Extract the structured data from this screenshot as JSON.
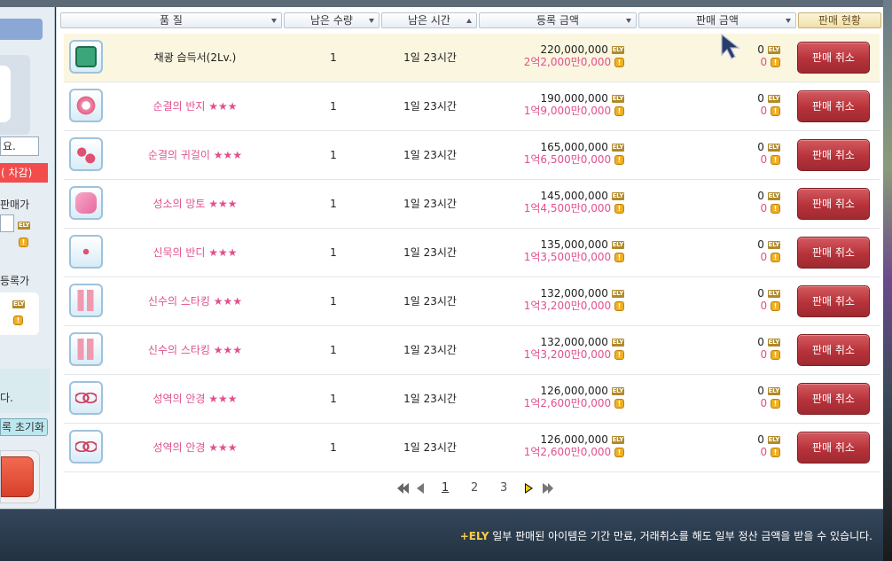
{
  "left_panel": {
    "field_text": "요.",
    "red_text": "( 차감)",
    "seller_label": "판매가",
    "register_label": "등록가",
    "info_text": "다.",
    "reset_label": "록 초기화"
  },
  "header": {
    "quality": "품 질",
    "remaining_qty": "남은 수량",
    "remaining_time": "남은 시간",
    "register_price": "등록 금액",
    "sale_price": "판매 금액",
    "sale_status": "판매 현황"
  },
  "ely_label": "ELY",
  "cancel_label": "판매 취소",
  "stars": "★★★",
  "rows": [
    {
      "name": "채광 습득서(2Lv.)",
      "stars": "",
      "qty": "1",
      "time": "1일 23시간",
      "price": "220,000,000",
      "price_won": "2억2,000만0,000",
      "sale": "0",
      "sale_won": "0",
      "icon": "book-icon",
      "highlight": true
    },
    {
      "name": "순결의 반지",
      "stars": "★★★",
      "qty": "1",
      "time": "1일 23시간",
      "price": "190,000,000",
      "price_won": "1억9,000만0,000",
      "sale": "0",
      "sale_won": "0",
      "icon": "ring-icon",
      "highlight": false
    },
    {
      "name": "순결의 귀걸이",
      "stars": "★★★",
      "qty": "1",
      "time": "1일 23시간",
      "price": "165,000,000",
      "price_won": "1억6,500만0,000",
      "sale": "0",
      "sale_won": "0",
      "icon": "earring-icon",
      "highlight": false
    },
    {
      "name": "성소의 망토",
      "stars": "★★★",
      "qty": "1",
      "time": "1일 23시간",
      "price": "145,000,000",
      "price_won": "1억4,500만0,000",
      "sale": "0",
      "sale_won": "0",
      "icon": "cape-icon",
      "highlight": false
    },
    {
      "name": "신묵의 반디",
      "stars": "★★★",
      "qty": "1",
      "time": "1일 23시간",
      "price": "135,000,000",
      "price_won": "1억3,500만0,000",
      "sale": "0",
      "sale_won": "0",
      "icon": "headband-icon",
      "highlight": false
    },
    {
      "name": "신수의 스타킹",
      "stars": "★★★",
      "qty": "1",
      "time": "1일 23시간",
      "price": "132,000,000",
      "price_won": "1억3,200만0,000",
      "sale": "0",
      "sale_won": "0",
      "icon": "stocking-icon",
      "highlight": false
    },
    {
      "name": "신수의 스타킹",
      "stars": "★★★",
      "qty": "1",
      "time": "1일 23시간",
      "price": "132,000,000",
      "price_won": "1억3,200만0,000",
      "sale": "0",
      "sale_won": "0",
      "icon": "stocking-icon",
      "highlight": false
    },
    {
      "name": "성역의 안경",
      "stars": "★★★",
      "qty": "1",
      "time": "1일 23시간",
      "price": "126,000,000",
      "price_won": "1억2,600만0,000",
      "sale": "0",
      "sale_won": "0",
      "icon": "glasses-icon",
      "highlight": false
    },
    {
      "name": "성역의 안경",
      "stars": "★★★",
      "qty": "1",
      "time": "1일 23시간",
      "price": "126,000,000",
      "price_won": "1억2,600만0,000",
      "sale": "0",
      "sale_won": "0",
      "icon": "glasses-icon",
      "highlight": false
    }
  ],
  "pager": {
    "pages": [
      "1",
      "2",
      "3"
    ],
    "current": "1"
  },
  "footer": {
    "badge": "+ELY",
    "note": "일부 판매된 아이템은 기간 만료, 거래취소를 해도 일부 정산 금액을 받을 수 있습니다."
  },
  "coin_glyph": "!",
  "colors": {
    "pink_text": "#e0508f",
    "cancel_button": "#b7323a",
    "highlight_row": "#fbf6df",
    "footer_bg": "#2b3b4c"
  }
}
